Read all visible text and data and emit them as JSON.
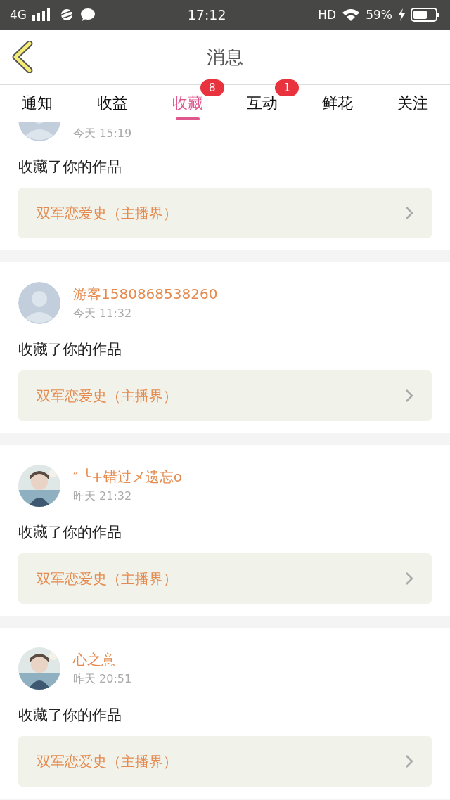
{
  "status_bar": {
    "network": "4G",
    "time": "17:12",
    "hd": "HD",
    "battery": "59%"
  },
  "header": {
    "title": "消息"
  },
  "tabs": [
    {
      "label": "通知",
      "selected": false
    },
    {
      "label": "收益",
      "selected": false
    },
    {
      "label": "收藏",
      "selected": true,
      "badge": "8"
    },
    {
      "label": "互动",
      "selected": false,
      "badge": "1"
    },
    {
      "label": "鲜花",
      "selected": false
    },
    {
      "label": "关注",
      "selected": false
    }
  ],
  "messages": [
    {
      "kind": "partial",
      "avatar": {
        "kind": "default"
      },
      "time": "今天 15:19",
      "action": "收藏了你的作品",
      "work": "双军恋爱史（主播界）"
    },
    {
      "kind": "full",
      "avatar": {
        "kind": "default"
      },
      "name": "游客1580868538260",
      "time": "今天 11:32",
      "action": "收藏了你的作品",
      "work": "双军恋爱史（主播界）"
    },
    {
      "kind": "full",
      "name": "″ ╰+错过メ遗忘o",
      "time": "昨天 21:32",
      "action": "收藏了你的作品",
      "work": "双军恋爱史（主播界）"
    },
    {
      "kind": "full",
      "name": "心之意",
      "time": "昨天 20:51",
      "action": "收藏了你的作品",
      "work": "双军恋爱史（主播界）"
    }
  ]
}
